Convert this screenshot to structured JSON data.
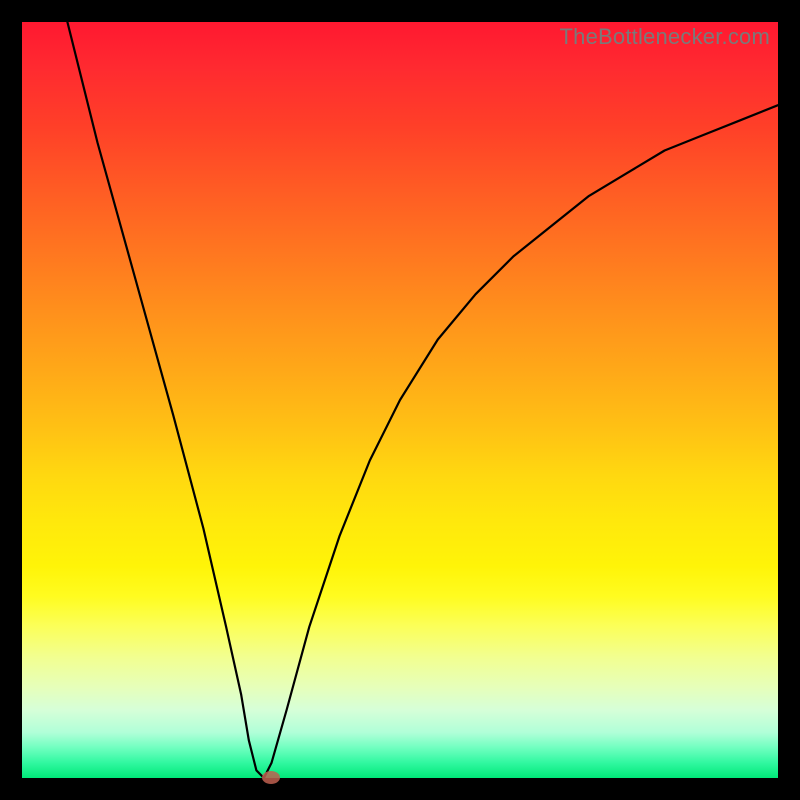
{
  "watermark": "TheBottlenecker.com",
  "colors": {
    "frame": "#000000",
    "curve": "#000000",
    "marker": "#c06050",
    "gradient_top": "#ff1830",
    "gradient_bottom": "#00e878"
  },
  "chart_data": {
    "type": "line",
    "title": "",
    "xlabel": "",
    "ylabel": "",
    "xlim": [
      0,
      100
    ],
    "ylim": [
      0,
      100
    ],
    "x": [
      6,
      10,
      15,
      20,
      24,
      27,
      29,
      30,
      31,
      32,
      33,
      35,
      38,
      42,
      46,
      50,
      55,
      60,
      65,
      70,
      75,
      80,
      85,
      90,
      95,
      100
    ],
    "y": [
      100,
      84,
      66,
      48,
      33,
      20,
      11,
      5,
      1,
      0,
      2,
      9,
      20,
      32,
      42,
      50,
      58,
      64,
      69,
      73,
      77,
      80,
      83,
      85,
      87,
      89
    ],
    "marker": {
      "x": 33,
      "y": 0
    },
    "annotations": []
  }
}
